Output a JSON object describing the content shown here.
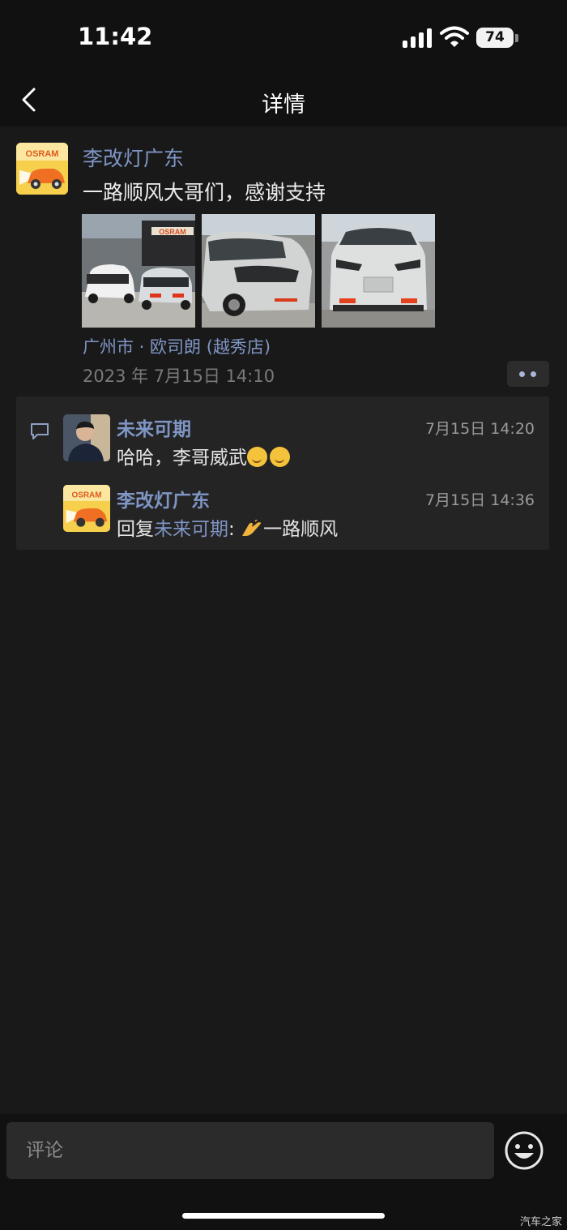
{
  "status_bar": {
    "time": "11:42",
    "battery": "74"
  },
  "nav": {
    "title": "详情"
  },
  "post": {
    "avatar_brand": "OSRAM",
    "author": "李改灯广东",
    "text": "一路顺风大哥们，感谢支持",
    "location": "广州市 · 欧司朗 (越秀店)",
    "timestamp": "2023 年 7月15日 14:10",
    "photos": [
      {
        "name": "photo-two-white-cars",
        "store_sign": "OSRAM"
      },
      {
        "name": "photo-car-front-side"
      },
      {
        "name": "photo-car-front"
      }
    ]
  },
  "comments": [
    {
      "author": "未来可期",
      "time": "7月15日 14:20",
      "text": "哈哈，李哥威武",
      "emoji": [
        "smiling-face",
        "smiling-face"
      ]
    },
    {
      "author": "李改灯广东",
      "time": "7月15日 14:36",
      "prefix": "回复",
      "mention": "未来可期",
      "separator": ": ",
      "emoji": [
        "clapping-hand"
      ],
      "text": "一路顺风",
      "avatar_brand": "OSRAM"
    }
  ],
  "input": {
    "placeholder": "评论"
  },
  "watermark": "汽车之家",
  "colors": {
    "background": "#191919",
    "link": "#7f95c4",
    "panel": "#242424",
    "bars": "#111111"
  }
}
